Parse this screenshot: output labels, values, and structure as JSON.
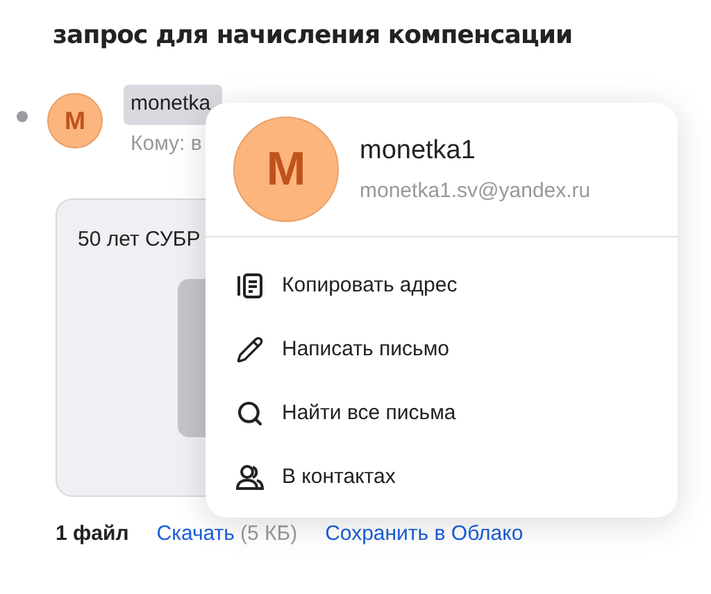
{
  "subject": "запрос для начисления компенсации",
  "message": {
    "unread": true,
    "avatar_letter": "M",
    "sender": "monetka",
    "to": "Кому: в"
  },
  "attachment": {
    "preview_text": "50 лет СУБР"
  },
  "files": {
    "count": "1 файл",
    "download": "Скачать",
    "size": "(5 КБ)",
    "save": "Сохранить в Облако"
  },
  "popup": {
    "avatar_letter": "M",
    "name": "monetka1",
    "email": "monetka1.sv@yandex.ru",
    "items": [
      {
        "kind": "copy",
        "label": "Копировать адрес"
      },
      {
        "kind": "write",
        "label": "Написать письмо"
      },
      {
        "kind": "search",
        "label": "Найти все письма"
      },
      {
        "kind": "contacts",
        "label": "В контактах"
      }
    ]
  }
}
